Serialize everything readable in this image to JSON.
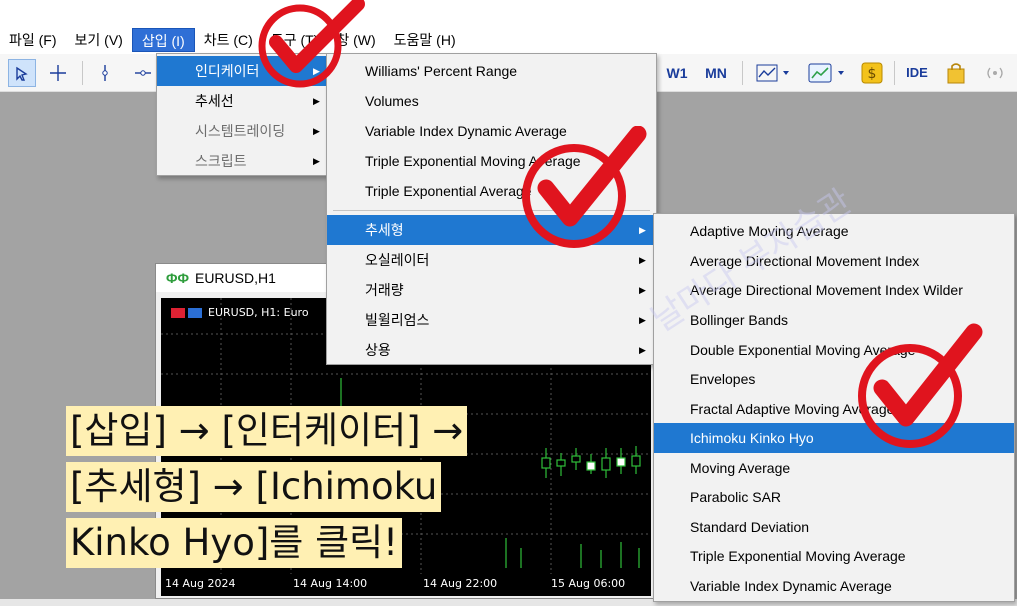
{
  "menubar": {
    "items": [
      "파일 (F)",
      "보기 (V)",
      "삽입 (I)",
      "차트 (C)",
      "도구 (T)",
      "창 (W)",
      "도움말 (H)"
    ]
  },
  "toolbar": {
    "timeframes": [
      "W1",
      "MN"
    ],
    "ide_label": "IDE"
  },
  "insert_menu": {
    "items": [
      {
        "label": "인디케이터",
        "state": "selected"
      },
      {
        "label": "추세선",
        "state": "normal"
      },
      {
        "label": "시스템트레이딩",
        "state": "disabled"
      },
      {
        "label": "스크립트",
        "state": "disabled"
      }
    ]
  },
  "indicator_menu": {
    "items": [
      "Williams' Percent Range",
      "Volumes",
      "Variable Index Dynamic Average",
      "Triple Exponential Moving Average",
      "Triple Exponential Average"
    ],
    "submenus": [
      "추세형",
      "오실레이터",
      "거래량",
      "빌윌리엄스",
      "상용"
    ]
  },
  "trend_menu": {
    "items": [
      "Adaptive Moving Average",
      "Average Directional Movement Index",
      "Average Directional Movement Index Wilder",
      "Bollinger Bands",
      "Double Exponential Moving Average",
      "Envelopes",
      "Fractal Adaptive Moving Average",
      "Ichimoku Kinko Hyo",
      "Moving Average",
      "Parabolic SAR",
      "Standard Deviation",
      "Triple Exponential Moving Average",
      "Variable Index Dynamic Average"
    ],
    "selected_index": 7
  },
  "chart_window": {
    "title": "EURUSD,H1",
    "info_label": "EURUSD, H1: Euro",
    "dates": [
      "14 Aug 2024",
      "14 Aug 14:00",
      "14 Aug 22:00",
      "15 Aug 06:00"
    ]
  },
  "instruction": {
    "line1": "[삽입] → [인터케이터] →",
    "line2": "[추세형] → [Ichimoku",
    "line3": "Kinko Hyo]를 클릭!"
  },
  "watermark": "날마다 부자습관",
  "colors": {
    "accent": "#1f78d1",
    "checkmark": "#e0141e",
    "instruction_bg": "#fff0b3",
    "workspace": "#a3a3a3"
  }
}
